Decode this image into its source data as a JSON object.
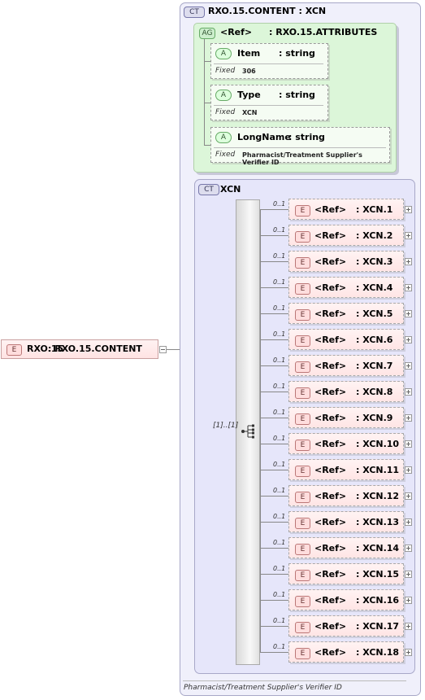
{
  "root": {
    "badge": "E",
    "name": "RXO.15",
    "type": ": RXO.15.CONTENT"
  },
  "complex_type": {
    "badge": "CT",
    "title": "RXO.15.CONTENT : XCN"
  },
  "attribute_group": {
    "badge": "AG",
    "ref": "<Ref>",
    "type": ": RXO.15.ATTRIBUTES",
    "attributes": [
      {
        "badge": "A",
        "name": "Item",
        "type": ": string",
        "fixed_label": "Fixed",
        "fixed_value": "306"
      },
      {
        "badge": "A",
        "name": "Type",
        "type": ": string",
        "fixed_label": "Fixed",
        "fixed_value": "XCN"
      },
      {
        "badge": "A",
        "name": "LongName",
        "type": ": string",
        "fixed_label": "Fixed",
        "fixed_value": "Pharmacist/Treatment Supplier's Verifier ID"
      }
    ]
  },
  "inner_type": {
    "badge": "CT",
    "title": "XCN",
    "sequence_occurrence": "[1]..[1]"
  },
  "children": [
    {
      "occ": "0..1",
      "badge": "E",
      "ref": "<Ref>",
      "type": ": XCN.1"
    },
    {
      "occ": "0..1",
      "badge": "E",
      "ref": "<Ref>",
      "type": ": XCN.2"
    },
    {
      "occ": "0..1",
      "badge": "E",
      "ref": "<Ref>",
      "type": ": XCN.3"
    },
    {
      "occ": "0..1",
      "badge": "E",
      "ref": "<Ref>",
      "type": ": XCN.4"
    },
    {
      "occ": "0..1",
      "badge": "E",
      "ref": "<Ref>",
      "type": ": XCN.5"
    },
    {
      "occ": "0..1",
      "badge": "E",
      "ref": "<Ref>",
      "type": ": XCN.6"
    },
    {
      "occ": "0..1",
      "badge": "E",
      "ref": "<Ref>",
      "type": ": XCN.7"
    },
    {
      "occ": "0..1",
      "badge": "E",
      "ref": "<Ref>",
      "type": ": XCN.8"
    },
    {
      "occ": "0..1",
      "badge": "E",
      "ref": "<Ref>",
      "type": ": XCN.9"
    },
    {
      "occ": "0..1",
      "badge": "E",
      "ref": "<Ref>",
      "type": ": XCN.10"
    },
    {
      "occ": "0..1",
      "badge": "E",
      "ref": "<Ref>",
      "type": ": XCN.11"
    },
    {
      "occ": "0..1",
      "badge": "E",
      "ref": "<Ref>",
      "type": ": XCN.12"
    },
    {
      "occ": "0..1",
      "badge": "E",
      "ref": "<Ref>",
      "type": ": XCN.13"
    },
    {
      "occ": "0..1",
      "badge": "E",
      "ref": "<Ref>",
      "type": ": XCN.14"
    },
    {
      "occ": "0..1",
      "badge": "E",
      "ref": "<Ref>",
      "type": ": XCN.15"
    },
    {
      "occ": "0..1",
      "badge": "E",
      "ref": "<Ref>",
      "type": ": XCN.16"
    },
    {
      "occ": "0..1",
      "badge": "E",
      "ref": "<Ref>",
      "type": ": XCN.17"
    },
    {
      "occ": "0..1",
      "badge": "E",
      "ref": "<Ref>",
      "type": ": XCN.18"
    }
  ],
  "documentation": "Pharmacist/Treatment Supplier's Verifier ID",
  "icons": [
    "element-badge-icon",
    "complex-type-badge-icon",
    "attribute-group-badge-icon",
    "attribute-badge-icon",
    "sequence-icon",
    "expand-icon",
    "collapse-icon"
  ]
}
